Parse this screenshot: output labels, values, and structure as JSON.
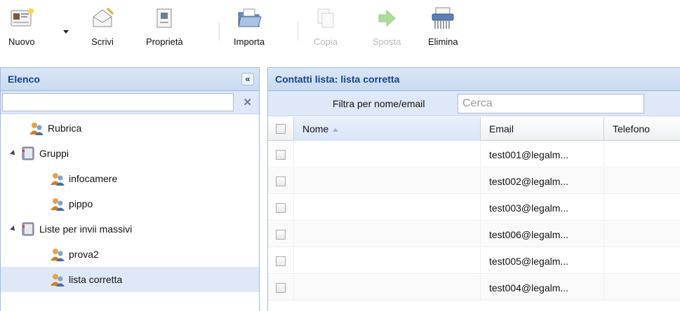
{
  "toolbar": {
    "buttons": [
      {
        "label": "Nuovo",
        "icon": "new-contact-icon",
        "disabled": false
      },
      {
        "label": "Scrivi",
        "icon": "write-mail-icon",
        "disabled": false
      },
      {
        "label": "Proprietà",
        "icon": "properties-icon",
        "disabled": false
      },
      {
        "label": "Importa",
        "icon": "folder-import-icon",
        "disabled": false
      },
      {
        "label": "Copia",
        "icon": "copy-icon",
        "disabled": true
      },
      {
        "label": "Sposta",
        "icon": "move-arrow-icon",
        "disabled": true
      },
      {
        "label": "Elimina",
        "icon": "shredder-delete-icon",
        "disabled": false
      }
    ]
  },
  "left_panel": {
    "title": "Elenco",
    "collapse_glyph": "«",
    "filter_value": "",
    "clear_glyph": "✕",
    "tree": [
      {
        "label": "Rubrica",
        "icon": "contacts-group-icon",
        "expandable": false,
        "selected": false
      },
      {
        "label": "Gruppi",
        "icon": "addressbook-icon",
        "expandable": true,
        "selected": false
      },
      {
        "label": "infocamere",
        "icon": "contacts-group-icon",
        "expandable": false,
        "selected": false
      },
      {
        "label": "pippo",
        "icon": "contacts-group-icon",
        "expandable": false,
        "selected": false
      },
      {
        "label": "Liste per invii massivi",
        "icon": "addressbook-icon",
        "expandable": true,
        "selected": false
      },
      {
        "label": "prova2",
        "icon": "contacts-group-icon",
        "expandable": false,
        "selected": false
      },
      {
        "label": "lista corretta",
        "icon": "contacts-group-icon",
        "expandable": false,
        "selected": true
      }
    ]
  },
  "right_panel": {
    "title": "Contatti lista: lista corretta",
    "filter_label": "Filtra per nome/email",
    "search_placeholder": "Cerca",
    "columns": {
      "name": "Nome",
      "email": "Email",
      "phone": "Telefono"
    },
    "rows": [
      {
        "name": "",
        "email": "test001@legalm...",
        "phone": ""
      },
      {
        "name": "",
        "email": "test002@legalm...",
        "phone": ""
      },
      {
        "name": "",
        "email": "test003@legalm...",
        "phone": ""
      },
      {
        "name": "",
        "email": "test006@legalm...",
        "phone": ""
      },
      {
        "name": "",
        "email": "test005@legalm...",
        "phone": ""
      },
      {
        "name": "",
        "email": "test004@legalm...",
        "phone": ""
      }
    ]
  },
  "colors": {
    "panel_border": "#99bbe8",
    "header_text": "#15428b",
    "header_bg": "#c9daf0",
    "selected_row": "#dfe8f6"
  }
}
